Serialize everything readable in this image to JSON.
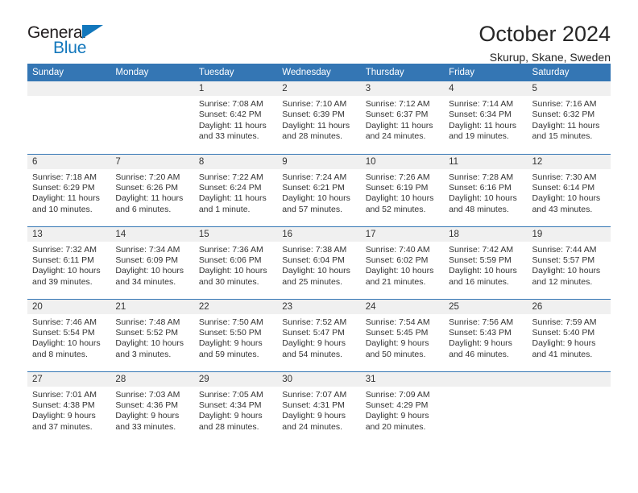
{
  "brand": {
    "name_top": "General",
    "name_bottom": "Blue",
    "triangle_color": "#1277bc",
    "text_color": "#231f20"
  },
  "header": {
    "title": "October 2024",
    "location": "Skurup, Skane, Sweden"
  },
  "theme": {
    "header_blue": "#3476b4",
    "daynum_bg": "#f0f0f0",
    "text": "#333333"
  },
  "calendar": {
    "weekdays": [
      "Sunday",
      "Monday",
      "Tuesday",
      "Wednesday",
      "Thursday",
      "Friday",
      "Saturday"
    ],
    "weeks": [
      [
        {
          "day": "",
          "blank": true
        },
        {
          "day": "",
          "blank": true
        },
        {
          "day": "1",
          "sunrise": "Sunrise: 7:08 AM",
          "sunset": "Sunset: 6:42 PM",
          "daylight": "Daylight: 11 hours and 33 minutes."
        },
        {
          "day": "2",
          "sunrise": "Sunrise: 7:10 AM",
          "sunset": "Sunset: 6:39 PM",
          "daylight": "Daylight: 11 hours and 28 minutes."
        },
        {
          "day": "3",
          "sunrise": "Sunrise: 7:12 AM",
          "sunset": "Sunset: 6:37 PM",
          "daylight": "Daylight: 11 hours and 24 minutes."
        },
        {
          "day": "4",
          "sunrise": "Sunrise: 7:14 AM",
          "sunset": "Sunset: 6:34 PM",
          "daylight": "Daylight: 11 hours and 19 minutes."
        },
        {
          "day": "5",
          "sunrise": "Sunrise: 7:16 AM",
          "sunset": "Sunset: 6:32 PM",
          "daylight": "Daylight: 11 hours and 15 minutes."
        }
      ],
      [
        {
          "day": "6",
          "sunrise": "Sunrise: 7:18 AM",
          "sunset": "Sunset: 6:29 PM",
          "daylight": "Daylight: 11 hours and 10 minutes."
        },
        {
          "day": "7",
          "sunrise": "Sunrise: 7:20 AM",
          "sunset": "Sunset: 6:26 PM",
          "daylight": "Daylight: 11 hours and 6 minutes."
        },
        {
          "day": "8",
          "sunrise": "Sunrise: 7:22 AM",
          "sunset": "Sunset: 6:24 PM",
          "daylight": "Daylight: 11 hours and 1 minute."
        },
        {
          "day": "9",
          "sunrise": "Sunrise: 7:24 AM",
          "sunset": "Sunset: 6:21 PM",
          "daylight": "Daylight: 10 hours and 57 minutes."
        },
        {
          "day": "10",
          "sunrise": "Sunrise: 7:26 AM",
          "sunset": "Sunset: 6:19 PM",
          "daylight": "Daylight: 10 hours and 52 minutes."
        },
        {
          "day": "11",
          "sunrise": "Sunrise: 7:28 AM",
          "sunset": "Sunset: 6:16 PM",
          "daylight": "Daylight: 10 hours and 48 minutes."
        },
        {
          "day": "12",
          "sunrise": "Sunrise: 7:30 AM",
          "sunset": "Sunset: 6:14 PM",
          "daylight": "Daylight: 10 hours and 43 minutes."
        }
      ],
      [
        {
          "day": "13",
          "sunrise": "Sunrise: 7:32 AM",
          "sunset": "Sunset: 6:11 PM",
          "daylight": "Daylight: 10 hours and 39 minutes."
        },
        {
          "day": "14",
          "sunrise": "Sunrise: 7:34 AM",
          "sunset": "Sunset: 6:09 PM",
          "daylight": "Daylight: 10 hours and 34 minutes."
        },
        {
          "day": "15",
          "sunrise": "Sunrise: 7:36 AM",
          "sunset": "Sunset: 6:06 PM",
          "daylight": "Daylight: 10 hours and 30 minutes."
        },
        {
          "day": "16",
          "sunrise": "Sunrise: 7:38 AM",
          "sunset": "Sunset: 6:04 PM",
          "daylight": "Daylight: 10 hours and 25 minutes."
        },
        {
          "day": "17",
          "sunrise": "Sunrise: 7:40 AM",
          "sunset": "Sunset: 6:02 PM",
          "daylight": "Daylight: 10 hours and 21 minutes."
        },
        {
          "day": "18",
          "sunrise": "Sunrise: 7:42 AM",
          "sunset": "Sunset: 5:59 PM",
          "daylight": "Daylight: 10 hours and 16 minutes."
        },
        {
          "day": "19",
          "sunrise": "Sunrise: 7:44 AM",
          "sunset": "Sunset: 5:57 PM",
          "daylight": "Daylight: 10 hours and 12 minutes."
        }
      ],
      [
        {
          "day": "20",
          "sunrise": "Sunrise: 7:46 AM",
          "sunset": "Sunset: 5:54 PM",
          "daylight": "Daylight: 10 hours and 8 minutes."
        },
        {
          "day": "21",
          "sunrise": "Sunrise: 7:48 AM",
          "sunset": "Sunset: 5:52 PM",
          "daylight": "Daylight: 10 hours and 3 minutes."
        },
        {
          "day": "22",
          "sunrise": "Sunrise: 7:50 AM",
          "sunset": "Sunset: 5:50 PM",
          "daylight": "Daylight: 9 hours and 59 minutes."
        },
        {
          "day": "23",
          "sunrise": "Sunrise: 7:52 AM",
          "sunset": "Sunset: 5:47 PM",
          "daylight": "Daylight: 9 hours and 54 minutes."
        },
        {
          "day": "24",
          "sunrise": "Sunrise: 7:54 AM",
          "sunset": "Sunset: 5:45 PM",
          "daylight": "Daylight: 9 hours and 50 minutes."
        },
        {
          "day": "25",
          "sunrise": "Sunrise: 7:56 AM",
          "sunset": "Sunset: 5:43 PM",
          "daylight": "Daylight: 9 hours and 46 minutes."
        },
        {
          "day": "26",
          "sunrise": "Sunrise: 7:59 AM",
          "sunset": "Sunset: 5:40 PM",
          "daylight": "Daylight: 9 hours and 41 minutes."
        }
      ],
      [
        {
          "day": "27",
          "sunrise": "Sunrise: 7:01 AM",
          "sunset": "Sunset: 4:38 PM",
          "daylight": "Daylight: 9 hours and 37 minutes."
        },
        {
          "day": "28",
          "sunrise": "Sunrise: 7:03 AM",
          "sunset": "Sunset: 4:36 PM",
          "daylight": "Daylight: 9 hours and 33 minutes."
        },
        {
          "day": "29",
          "sunrise": "Sunrise: 7:05 AM",
          "sunset": "Sunset: 4:34 PM",
          "daylight": "Daylight: 9 hours and 28 minutes."
        },
        {
          "day": "30",
          "sunrise": "Sunrise: 7:07 AM",
          "sunset": "Sunset: 4:31 PM",
          "daylight": "Daylight: 9 hours and 24 minutes."
        },
        {
          "day": "31",
          "sunrise": "Sunrise: 7:09 AM",
          "sunset": "Sunset: 4:29 PM",
          "daylight": "Daylight: 9 hours and 20 minutes."
        },
        {
          "day": "",
          "blank": true
        },
        {
          "day": "",
          "blank": true
        }
      ]
    ]
  }
}
